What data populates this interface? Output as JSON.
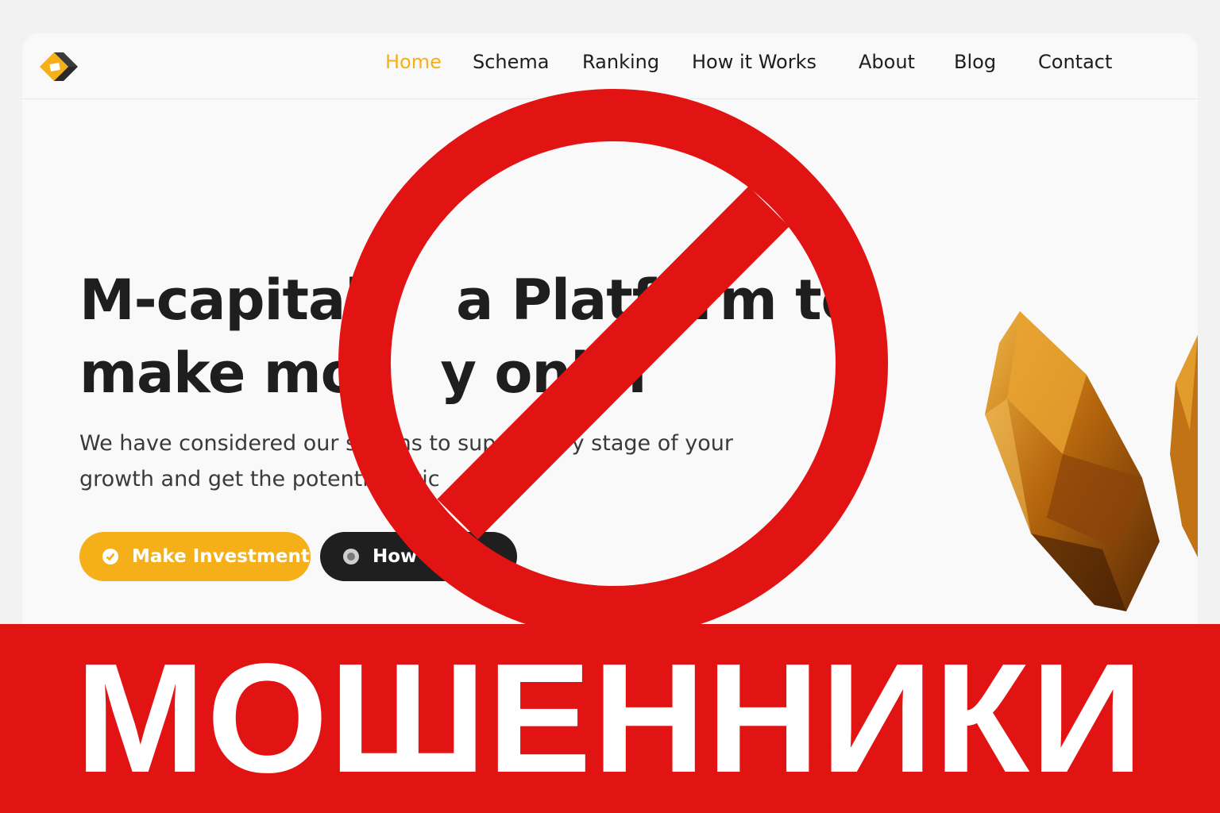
{
  "colors": {
    "accent": "#f5b019",
    "dark_button": "#1f1f1f",
    "warning_red": "#e11313",
    "text": "#1e1e1e"
  },
  "nav": {
    "logo_icon": "cube-logo-icon",
    "items": [
      {
        "label": "Home",
        "active": true
      },
      {
        "label": "Schema"
      },
      {
        "label": "Ranking"
      },
      {
        "label": "How it Works"
      },
      {
        "label": "About"
      },
      {
        "label": "Blog"
      },
      {
        "label": "Contact"
      }
    ]
  },
  "hero": {
    "title_line1": "M-capital     a Platform to",
    "title_line2": "make mor   y onlin",
    "subtitle_line1": "We have considered our s      ns to sup      very stage of your",
    "subtitle_line2": "growth and get the potenti      vic",
    "primary_button": {
      "label": "Make Investment",
      "icon": "check-circle-icon"
    },
    "secondary_button": {
      "label": "How",
      "icon": "play-circle-icon"
    }
  },
  "overlay": {
    "prohibition_icon": "prohibited-sign-icon",
    "banner_text": "МОШЕННИКИ"
  }
}
